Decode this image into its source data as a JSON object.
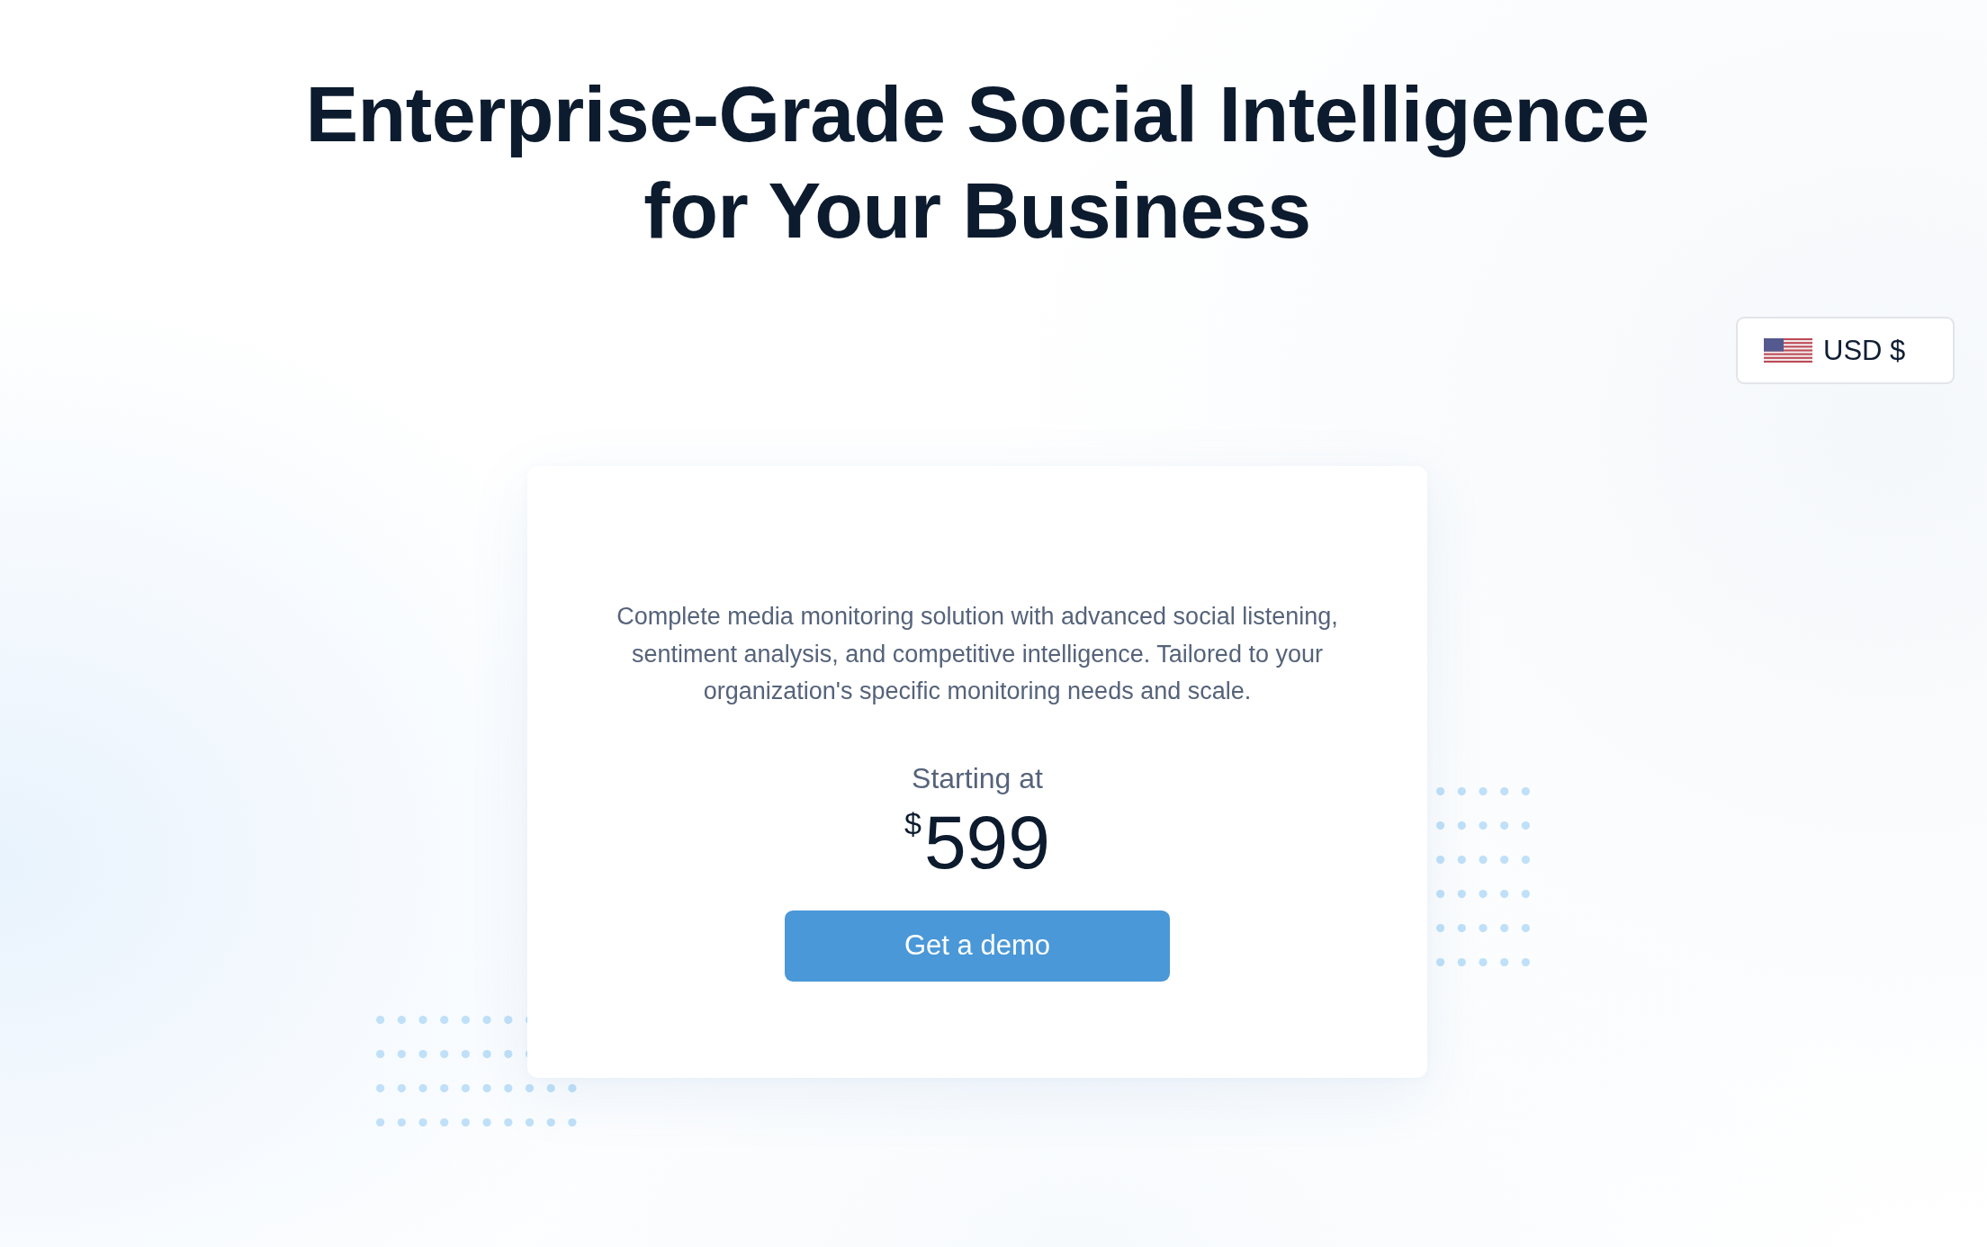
{
  "heading": "Enterprise-Grade Social Intelligence for Your Business",
  "currency_selector": {
    "label": "USD $"
  },
  "plan": {
    "description": "Complete media monitoring solution with advanced social listening, sentiment analysis, and competitive intelligence. Tailored to your organization's specific monitoring needs and scale.",
    "price_prefix": "Starting at",
    "currency_symbol": "$",
    "price": "599",
    "cta": "Get a demo"
  }
}
